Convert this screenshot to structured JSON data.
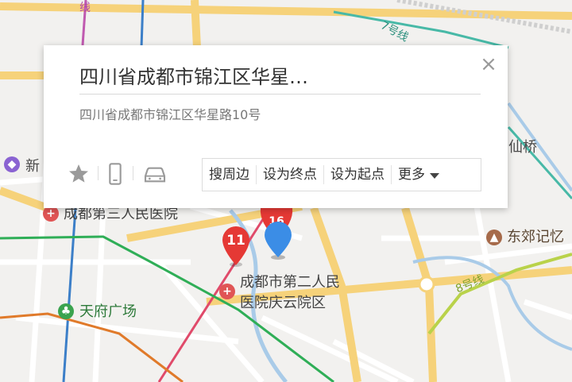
{
  "map": {
    "colors": {
      "background": "#eeeeec",
      "road_major": "#f6d27a",
      "road_minor": "#ffffff",
      "metro_line_1": "#3c7fc8",
      "metro_line_2": "#e04a6a",
      "metro_line_4": "#2fae57",
      "metro_line_7": "#48b9a7",
      "metro_line_8": "#b9d24a",
      "river": "#a9cbe8"
    },
    "labels": {
      "poi_new": "新",
      "hospital_third": "成都第三人民医院",
      "hospital_second_line1": "成都市第二人民",
      "hospital_second_line2": "医院庆云院区",
      "tianfu_square": "天府广场",
      "xianqiao": "仙桥",
      "dongjiao": "东郊记忆",
      "line_7": "7号线",
      "line_8": "8号线",
      "line_top": "线"
    },
    "markers": {
      "marker_11": "11",
      "marker_16": "16"
    }
  },
  "popup": {
    "title": "四川省成都市锦江区华星…",
    "address": "四川省成都市锦江区华星路10号",
    "close_symbol": "×",
    "actions": {
      "search_nearby": "搜周边",
      "set_destination": "设为终点",
      "set_origin": "设为起点",
      "more": "更多"
    }
  }
}
